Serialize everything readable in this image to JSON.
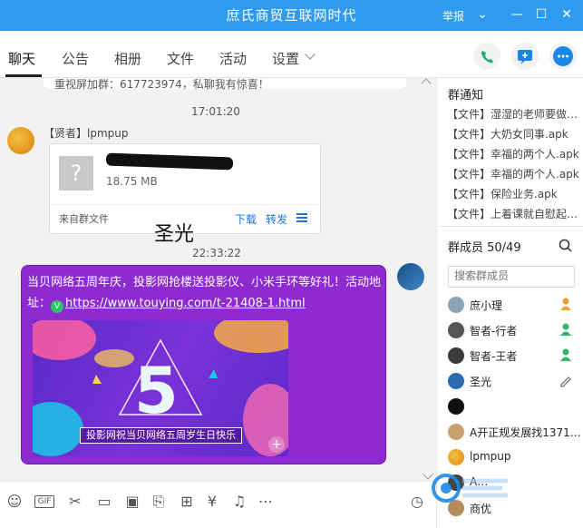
{
  "window": {
    "title": "庶氏商贸互联网时代",
    "report_label": "举报",
    "accent": "#2f9bf0"
  },
  "tabs": [
    {
      "label": "聊天"
    },
    {
      "label": "公告"
    },
    {
      "label": "相册"
    },
    {
      "label": "文件"
    },
    {
      "label": "活动"
    },
    {
      "label": "设置"
    }
  ],
  "chat": {
    "prev_message_partial": "重视屏加群：617723974，私聊我有惊喜！",
    "time1": "17:01:20",
    "sender1": "【贤者】lpmpup",
    "file": {
      "size": "18.75 MB",
      "source": "来自群文件",
      "download_label": "下载",
      "forward_label": "转发"
    },
    "overlay_label": "圣光",
    "time2": "22:33:22",
    "message_text": "当贝网络五周年庆，投影网抢楼送投影仪、小米手环等好礼！活动地址：",
    "message_link": "https://www.touying.com/t-21408-1.html",
    "banner_caption": "投影网祝当贝网络五周岁生日快乐",
    "banner_number": "5"
  },
  "side": {
    "notice_title": "群通知",
    "notices": [
      "【文件】湿湿的老师要做…",
      "【文件】大奶女同事.apk",
      "【文件】幸福的两个人.apk",
      "【文件】幸福的两个人.apk",
      "【文件】保险业务.apk",
      "【文件】上着课就自慰起…"
    ],
    "members_title": "群成员 50/49",
    "search_placeholder": "搜索群成员",
    "members": [
      {
        "name": "庶小理",
        "role": "owner"
      },
      {
        "name": "智者-行者",
        "role": "admin"
      },
      {
        "name": "智者-王者",
        "role": "admin"
      },
      {
        "name": "圣光",
        "role": "edit"
      },
      {
        "name": "",
        "role": ""
      },
      {
        "name": "A开正规发展找1371…",
        "role": ""
      },
      {
        "name": "lpmpup",
        "role": ""
      },
      {
        "name": "A…",
        "role": ""
      },
      {
        "name": "商优",
        "role": ""
      }
    ]
  },
  "toolbar": {
    "icons": [
      "emoji-icon",
      "gif-icon",
      "scissors-icon",
      "folder-icon",
      "image-icon",
      "red-packet-icon",
      "gift-icon",
      "money-icon",
      "bell-icon",
      "more-icon",
      "history-icon"
    ]
  }
}
